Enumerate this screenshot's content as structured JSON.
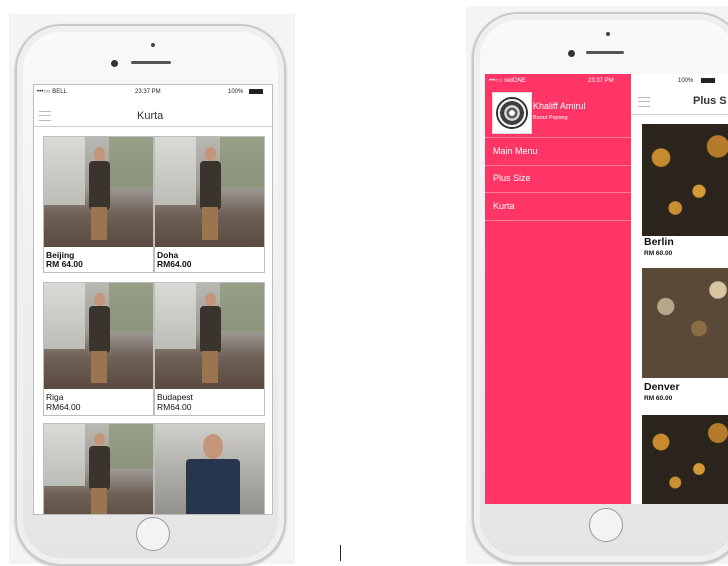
{
  "left_phone": {
    "status": {
      "carrier": "•••○○ BELL",
      "time": "23:37 PM",
      "battery": "100%"
    },
    "title": "Kurta",
    "products": [
      {
        "name": "Beijing",
        "price": "RM 64.00",
        "bold": true
      },
      {
        "name": "Doha",
        "price": "RM64.00",
        "bold": true
      },
      {
        "name": "Riga",
        "price": "RM64.00",
        "bold": false
      },
      {
        "name": "Budapest",
        "price": "RM64.00",
        "bold": false
      },
      {
        "name": "",
        "price": "",
        "bold": false
      },
      {
        "name": "",
        "price": "",
        "bold": false
      }
    ]
  },
  "right_phone": {
    "status": {
      "carrier": "•••○○ redONE",
      "time": "23:37 PM",
      "battery": "100%"
    },
    "title": "Plus S",
    "drawer": {
      "user_name": "Khaliff Amirul",
      "user_location": "Bunut Payong",
      "items": [
        "Main Menu",
        "Plus Size",
        "Kurta"
      ]
    },
    "products": [
      {
        "name": "Berlin",
        "price": "RM 60.00"
      },
      {
        "name": "Denver",
        "price": "RM 60.00"
      },
      {
        "name": "",
        "price": ""
      }
    ]
  },
  "colors": {
    "drawer": "#ff3565",
    "accent": "#ffffff"
  }
}
